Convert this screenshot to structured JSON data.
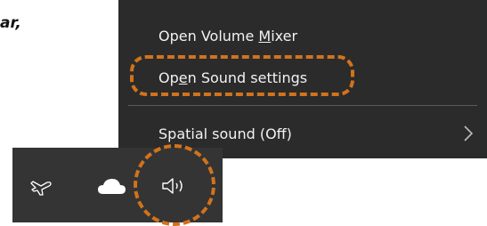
{
  "doc": {
    "text_fragment": "ar,"
  },
  "context_menu": {
    "items": [
      {
        "id": "volume-mixer",
        "before": "Open Volume ",
        "mnemonic": "M",
        "after": "ixer"
      },
      {
        "id": "sound-settings",
        "before": "Op",
        "mnemonic": "e",
        "after": "n Sound settings"
      },
      {
        "id": "spatial-sound",
        "label": "Spatial sound (Off)",
        "submenu": true
      }
    ],
    "background": "#2b2b2b",
    "text_color": "#f2f2f2"
  },
  "taskbar": {
    "icons": [
      "airplane-mode-icon",
      "onedrive-cloud-icon",
      "speaker-volume-icon"
    ],
    "background": "#343434"
  },
  "annotations": {
    "highlight_color": "#d1731c"
  }
}
